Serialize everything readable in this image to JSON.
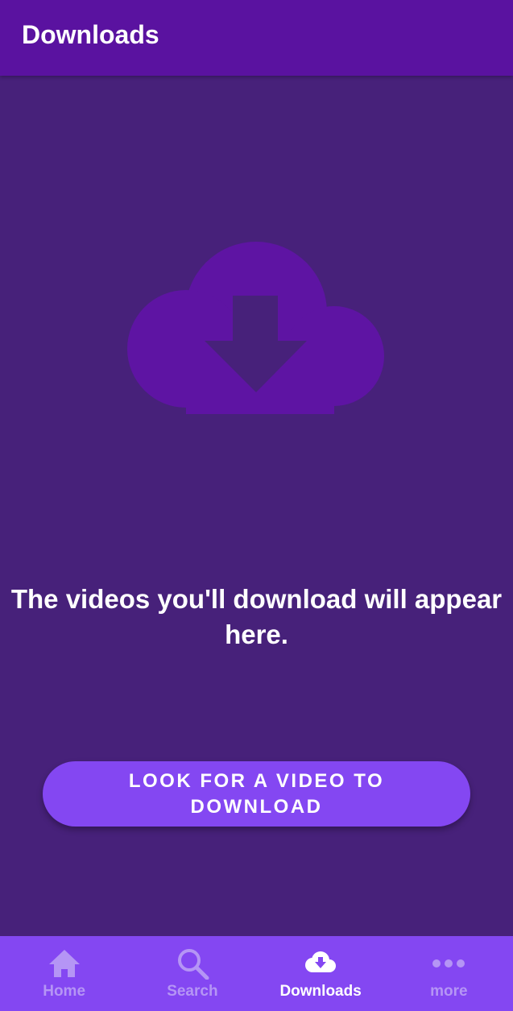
{
  "app_bar": {
    "title": "Downloads"
  },
  "empty_state": {
    "illustration_icon": "cloud-download-icon",
    "message": "The videos you'll download will appear here.",
    "button_label": "LOOK FOR A VIDEO TO DOWNLOAD"
  },
  "bottom_nav": {
    "items": [
      {
        "label": "Home",
        "icon": "home-icon",
        "active": false
      },
      {
        "label": "Search",
        "icon": "search-icon",
        "active": false
      },
      {
        "label": "Downloads",
        "icon": "cloud-download-icon",
        "active": true
      },
      {
        "label": "more",
        "icon": "more-dots-icon",
        "active": false
      }
    ]
  },
  "colors": {
    "background": "#47217a",
    "app_bar": "#5a12a0",
    "accent": "#8447f2",
    "illustration": "#5e14a3",
    "nav_inactive": "#b595f5",
    "nav_active": "#ffffff"
  }
}
